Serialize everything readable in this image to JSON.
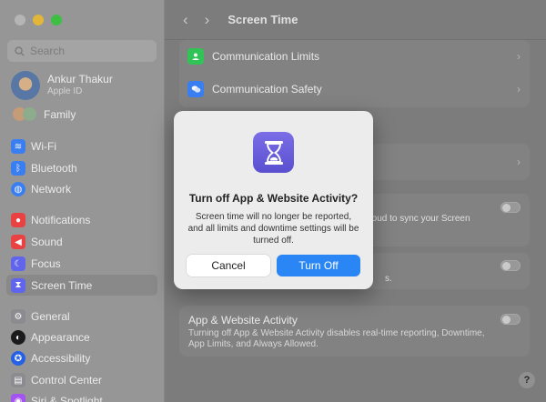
{
  "sidebar": {
    "search_placeholder": "Search",
    "user": {
      "name": "Ankur Thakur",
      "sub": "Apple ID"
    },
    "family": "Family",
    "items": [
      {
        "label": "Wi-Fi",
        "icon": "wifi-icon",
        "color": "#3b82f6"
      },
      {
        "label": "Bluetooth",
        "icon": "bluetooth-icon",
        "color": "#3b82f6"
      },
      {
        "label": "Network",
        "icon": "network-icon",
        "color": "#3b82f6"
      },
      {
        "label": "Notifications",
        "icon": "bell-icon",
        "color": "#ef4444"
      },
      {
        "label": "Sound",
        "icon": "speaker-icon",
        "color": "#ef4444"
      },
      {
        "label": "Focus",
        "icon": "moon-icon",
        "color": "#6366f1"
      },
      {
        "label": "Screen Time",
        "icon": "hourglass-icon",
        "color": "#6366f1"
      },
      {
        "label": "General",
        "icon": "gear-icon",
        "color": "#8e8e93"
      },
      {
        "label": "Appearance",
        "icon": "appearance-icon",
        "color": "#1c1c1e"
      },
      {
        "label": "Accessibility",
        "icon": "accessibility-icon",
        "color": "#2563eb"
      },
      {
        "label": "Control Center",
        "icon": "control-center-icon",
        "color": "#8e8e93"
      },
      {
        "label": "Siri & Spotlight",
        "icon": "siri-icon",
        "color": "#a855f7"
      }
    ]
  },
  "header": {
    "title": "Screen Time"
  },
  "main": {
    "comm_limits": "Communication Limits",
    "comm_safety": "Communication Safety",
    "partial_icloud": "iCloud to sync your Screen",
    "partial_s": "s.",
    "activity_title": "App & Website Activity",
    "activity_desc": "Turning off App & Website Activity disables real-time reporting, Downtime, App Limits, and Always Allowed."
  },
  "dialog": {
    "title": "Turn off App & Website Activity?",
    "text": "Screen time will no longer be reported, and all limits and downtime settings will be turned off.",
    "cancel": "Cancel",
    "confirm": "Turn Off"
  },
  "colors": {
    "accent": "#2a86f4",
    "icon_purple": "#6a5fdc"
  }
}
